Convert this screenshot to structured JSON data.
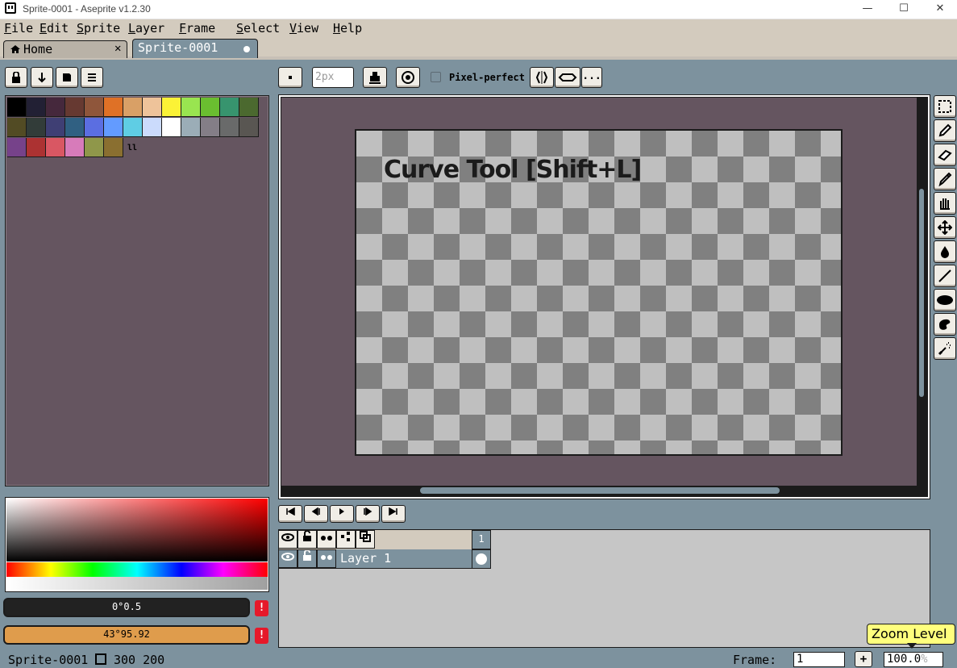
{
  "window": {
    "title": "Sprite-0001 - Aseprite v1.2.30",
    "minimize": "—",
    "maximize": "☐",
    "close": "✕"
  },
  "menu": [
    "File",
    "Edit",
    "Sprite",
    "Layer",
    "Frame",
    "Select",
    "View",
    "Help"
  ],
  "tabs": {
    "home": "Home",
    "home_close": "✕",
    "sprite": "Sprite-0001"
  },
  "context_bar": {
    "brush_size": "2px",
    "pixel_perfect": "Pixel-perfect",
    "more": "..."
  },
  "palette": {
    "colors": [
      "#000000",
      "#222034",
      "#45283c",
      "#663931",
      "#8f563b",
      "#df7126",
      "#d9a066",
      "#eec39a",
      "#fbf236",
      "#99e550",
      "#6abe30",
      "#37946e",
      "#4b692f",
      "#524b24",
      "#323c39",
      "#3f3f74",
      "#306082",
      "#5b6ee1",
      "#639bff",
      "#5fcde4",
      "#cbdbfc",
      "#ffffff",
      "#9badb7",
      "#847e87",
      "#696a6a",
      "#595652",
      "#76428a",
      "#ac3232",
      "#d95763",
      "#d77bba",
      "#8f974a",
      "#8a6f30"
    ],
    "grip": "ll"
  },
  "colors": {
    "foreground_label": "0°0.5",
    "background_label": "43°95.92",
    "foreground": "#222222",
    "background": "#df9c4c",
    "warning": "!"
  },
  "editor": {
    "tooltip": "Curve Tool [Shift+L]"
  },
  "tools": [
    "rectangular-marquee",
    "pencil",
    "eraser",
    "eyedropper",
    "hand",
    "move",
    "paint-bucket",
    "line",
    "ellipse",
    "contour",
    "spray"
  ],
  "timeline": {
    "frame_number": "1",
    "layer_name": "Layer 1"
  },
  "status": {
    "sprite_name": "Sprite-0001",
    "size": "300 200",
    "frame_label": "Frame:",
    "frame_value": "1",
    "add_frame": "+",
    "zoom_value": "100.0",
    "zoom_unit": "%",
    "zoom_tooltip": "Zoom Level"
  }
}
